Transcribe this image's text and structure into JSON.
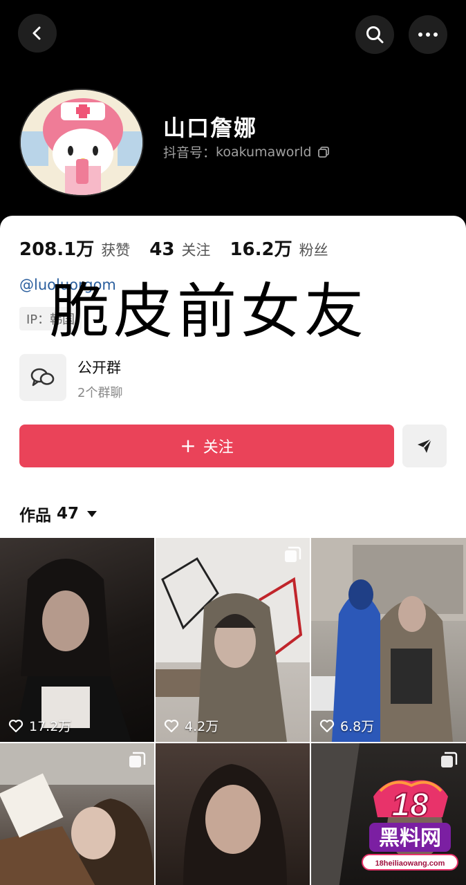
{
  "profile": {
    "name": "山口詹娜",
    "douyin_id_label": "抖音号：",
    "douyin_id": "koakumaworld"
  },
  "stats": {
    "likes_value": "208.1万",
    "likes_label": "获赞",
    "following_value": "43",
    "following_label": "关注",
    "followers_value": "16.2万",
    "followers_label": "粉丝"
  },
  "bio": {
    "handle": "@luoluorgom",
    "ip": "IP：韩国"
  },
  "overlay_text": "脆皮前女友",
  "group": {
    "name": "公开群",
    "count": "2个群聊"
  },
  "actions": {
    "follow_label": "关注"
  },
  "works": {
    "label": "作品",
    "count": "47"
  },
  "videos": [
    {
      "likes": "17.2万",
      "multi": false
    },
    {
      "likes": "4.2万",
      "multi": true
    },
    {
      "likes": "6.8万",
      "multi": false
    },
    {
      "likes": "",
      "multi": true
    },
    {
      "likes": "",
      "multi": false
    },
    {
      "likes": "",
      "multi": true
    }
  ],
  "watermark": {
    "number": "18",
    "name": "黑料网",
    "url": "18heiliaowang.com"
  },
  "colors": {
    "accent": "#ea4359",
    "link": "#2b5f9e",
    "background": "#000000"
  },
  "icons": [
    "back-icon",
    "search-icon",
    "more-icon",
    "copy-icon",
    "group-chat-icon",
    "share-icon",
    "heart-icon",
    "multi-photo-icon"
  ]
}
